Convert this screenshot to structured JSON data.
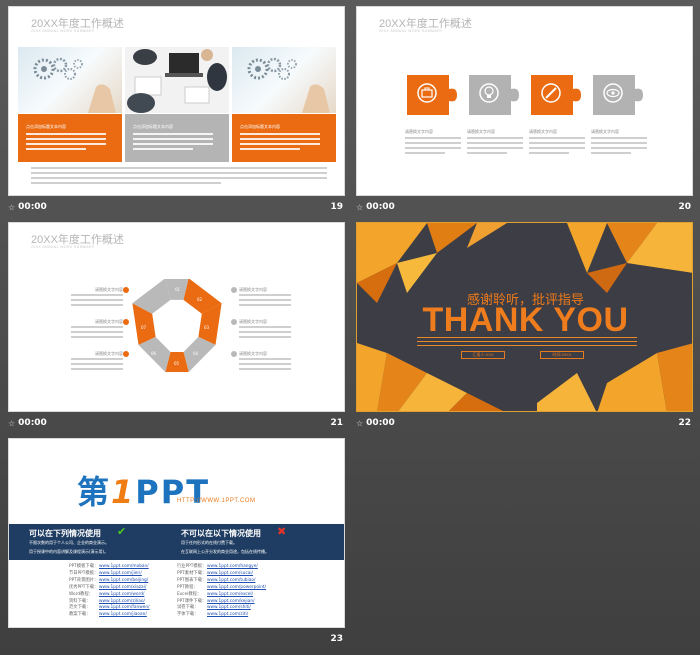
{
  "slides": [
    {
      "number": "19",
      "time": "00:00",
      "title": "20XX年度工作概述",
      "subtitle": "20XX ANNUAL WORK SUMMARY",
      "box_label": "点击添加标题文本内容"
    },
    {
      "number": "20",
      "time": "00:00",
      "title": "20XX年度工作概述",
      "subtitle": "20XX ANNUAL WORK SUMMARY",
      "puzzle_label": "请替换文字内容",
      "puzzle_icons": [
        "briefcase-icon",
        "bulb-icon",
        "pencil-icon",
        "eye-icon"
      ],
      "puzzle_colors": [
        "#ea6b11",
        "#b2b2b2",
        "#ea6b11",
        "#b2b2b2"
      ]
    },
    {
      "number": "21",
      "time": "00:00",
      "title": "20XX年度工作概述",
      "subtitle": "20XX ANNUAL WORK SUMMARY",
      "item_label": "请替换文字内容",
      "segments": [
        "01",
        "02",
        "03",
        "04",
        "05",
        "06",
        "07"
      ]
    },
    {
      "number": "22",
      "time": "00:00",
      "heading": "感谢聆听，批评指导",
      "main": "THANK YOU",
      "btn_left": "汇报人:XXX",
      "btn_right": "时间:20XX"
    },
    {
      "number": "23",
      "time": "00:00",
      "logo_text": "第1PPT",
      "logo_prefix": "第",
      "logo_one": "1",
      "logo_suffix": "PPT",
      "logo_url": "HTTP://WWW.1PPT.COM",
      "can_use_title": "可以在下列情况使用",
      "can_use_lines": [
        "不限次数的用于个人公司、企业的商业演示。",
        "用于授课中的内容讲解及课程演示(演示用)。"
      ],
      "cannot_use_title": "不可以在以下情况使用",
      "cannot_use_lines": [
        "用于任何形式的在线付费下载。",
        "在互联网上公开分发的商业用途，包括在线传播。"
      ],
      "links_left": [
        {
          "label": "PPT模板下载：",
          "url": "www.1ppt.com/moban/"
        },
        {
          "label": "节日PPT模板：",
          "url": "www.1ppt.com/jieri/"
        },
        {
          "label": "PPT背景图片：",
          "url": "www.1ppt.com/beijing/"
        },
        {
          "label": "优秀PPT下载：",
          "url": "www.1ppt.com/xiazai/"
        },
        {
          "label": "Word教程：",
          "url": "www.1ppt.com/word/"
        },
        {
          "label": "资料下载：",
          "url": "www.1ppt.com/ziliao/"
        },
        {
          "label": "范文下载：",
          "url": "www.1ppt.com/fanwen/"
        },
        {
          "label": "教案下载：",
          "url": "www.1ppt.com/jiaoan/"
        }
      ],
      "links_right": [
        {
          "label": "行业PPT模板：",
          "url": "www.1ppt.com/hangye/"
        },
        {
          "label": "PPT素材下载：",
          "url": "www.1ppt.com/sucai/"
        },
        {
          "label": "PPT图表下载：",
          "url": "www.1ppt.com/tubiao/"
        },
        {
          "label": "PPT教程：",
          "url": "www.1ppt.com/powerpoint/"
        },
        {
          "label": "Excel教程：",
          "url": "www.1ppt.com/excel/"
        },
        {
          "label": "PPT课件下载：",
          "url": "www.1ppt.com/kejian/"
        },
        {
          "label": "试卷下载：",
          "url": "www.1ppt.com/shiti/"
        },
        {
          "label": "字体下载：",
          "url": "www.1ppt.com/ziti/"
        }
      ]
    }
  ]
}
